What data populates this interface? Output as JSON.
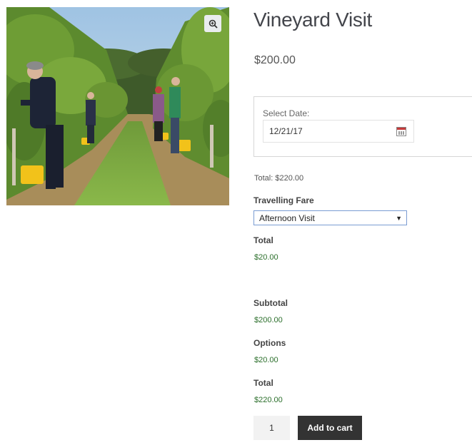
{
  "product": {
    "title": "Vineyard Visit",
    "price": "$200.00",
    "image_icon": "zoom-in-icon"
  },
  "booking": {
    "date_label": "Select Date:",
    "date_value": "12/21/17",
    "calendar_icon": "calendar-icon"
  },
  "total_line": "Total: $220.00",
  "fare": {
    "label": "Travelling Fare",
    "selected": "Afternoon Visit",
    "total_label": "Total",
    "total_value": "$20.00"
  },
  "summary": {
    "subtotal_label": "Subtotal",
    "subtotal_value": "$200.00",
    "options_label": "Options",
    "options_value": "$20.00",
    "total_label": "Total",
    "total_value": "$220.00"
  },
  "cart": {
    "quantity": "1",
    "button_label": "Add to cart"
  },
  "colors": {
    "accent_dark": "#333333",
    "price_green": "#2a6e2a",
    "select_border": "#7a9cd3"
  }
}
